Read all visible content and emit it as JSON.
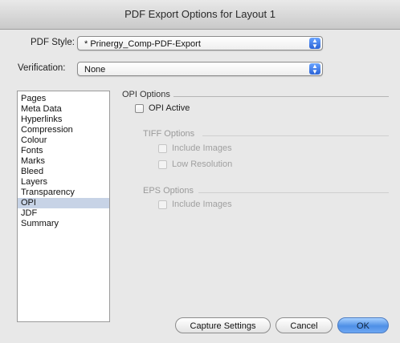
{
  "window": {
    "title": "PDF Export Options for Layout 1"
  },
  "pdf_style": {
    "label": "PDF Style:",
    "value": "* Prinergy_Comp-PDF-Export"
  },
  "verification": {
    "label": "Verification:",
    "value": "None"
  },
  "sidebar": {
    "items": [
      {
        "label": "Pages"
      },
      {
        "label": "Meta Data"
      },
      {
        "label": "Hyperlinks"
      },
      {
        "label": "Compression"
      },
      {
        "label": "Colour"
      },
      {
        "label": "Fonts"
      },
      {
        "label": "Marks"
      },
      {
        "label": "Bleed"
      },
      {
        "label": "Layers"
      },
      {
        "label": "Transparency"
      },
      {
        "label": "OPI",
        "selected": true
      },
      {
        "label": "JDF"
      },
      {
        "label": "Summary"
      }
    ]
  },
  "opi_options": {
    "title": "OPI Options",
    "opi_active_label": "OPI Active",
    "tiff_options": {
      "title": "TIFF Options",
      "include_images_label": "Include Images",
      "low_resolution_label": "Low Resolution"
    },
    "eps_options": {
      "title": "EPS Options",
      "include_images_label": "Include Images"
    }
  },
  "buttons": {
    "capture_settings": "Capture Settings",
    "cancel": "Cancel",
    "ok": "OK"
  },
  "icons": {
    "popup_arrows": "up-down-arrows-icon"
  }
}
